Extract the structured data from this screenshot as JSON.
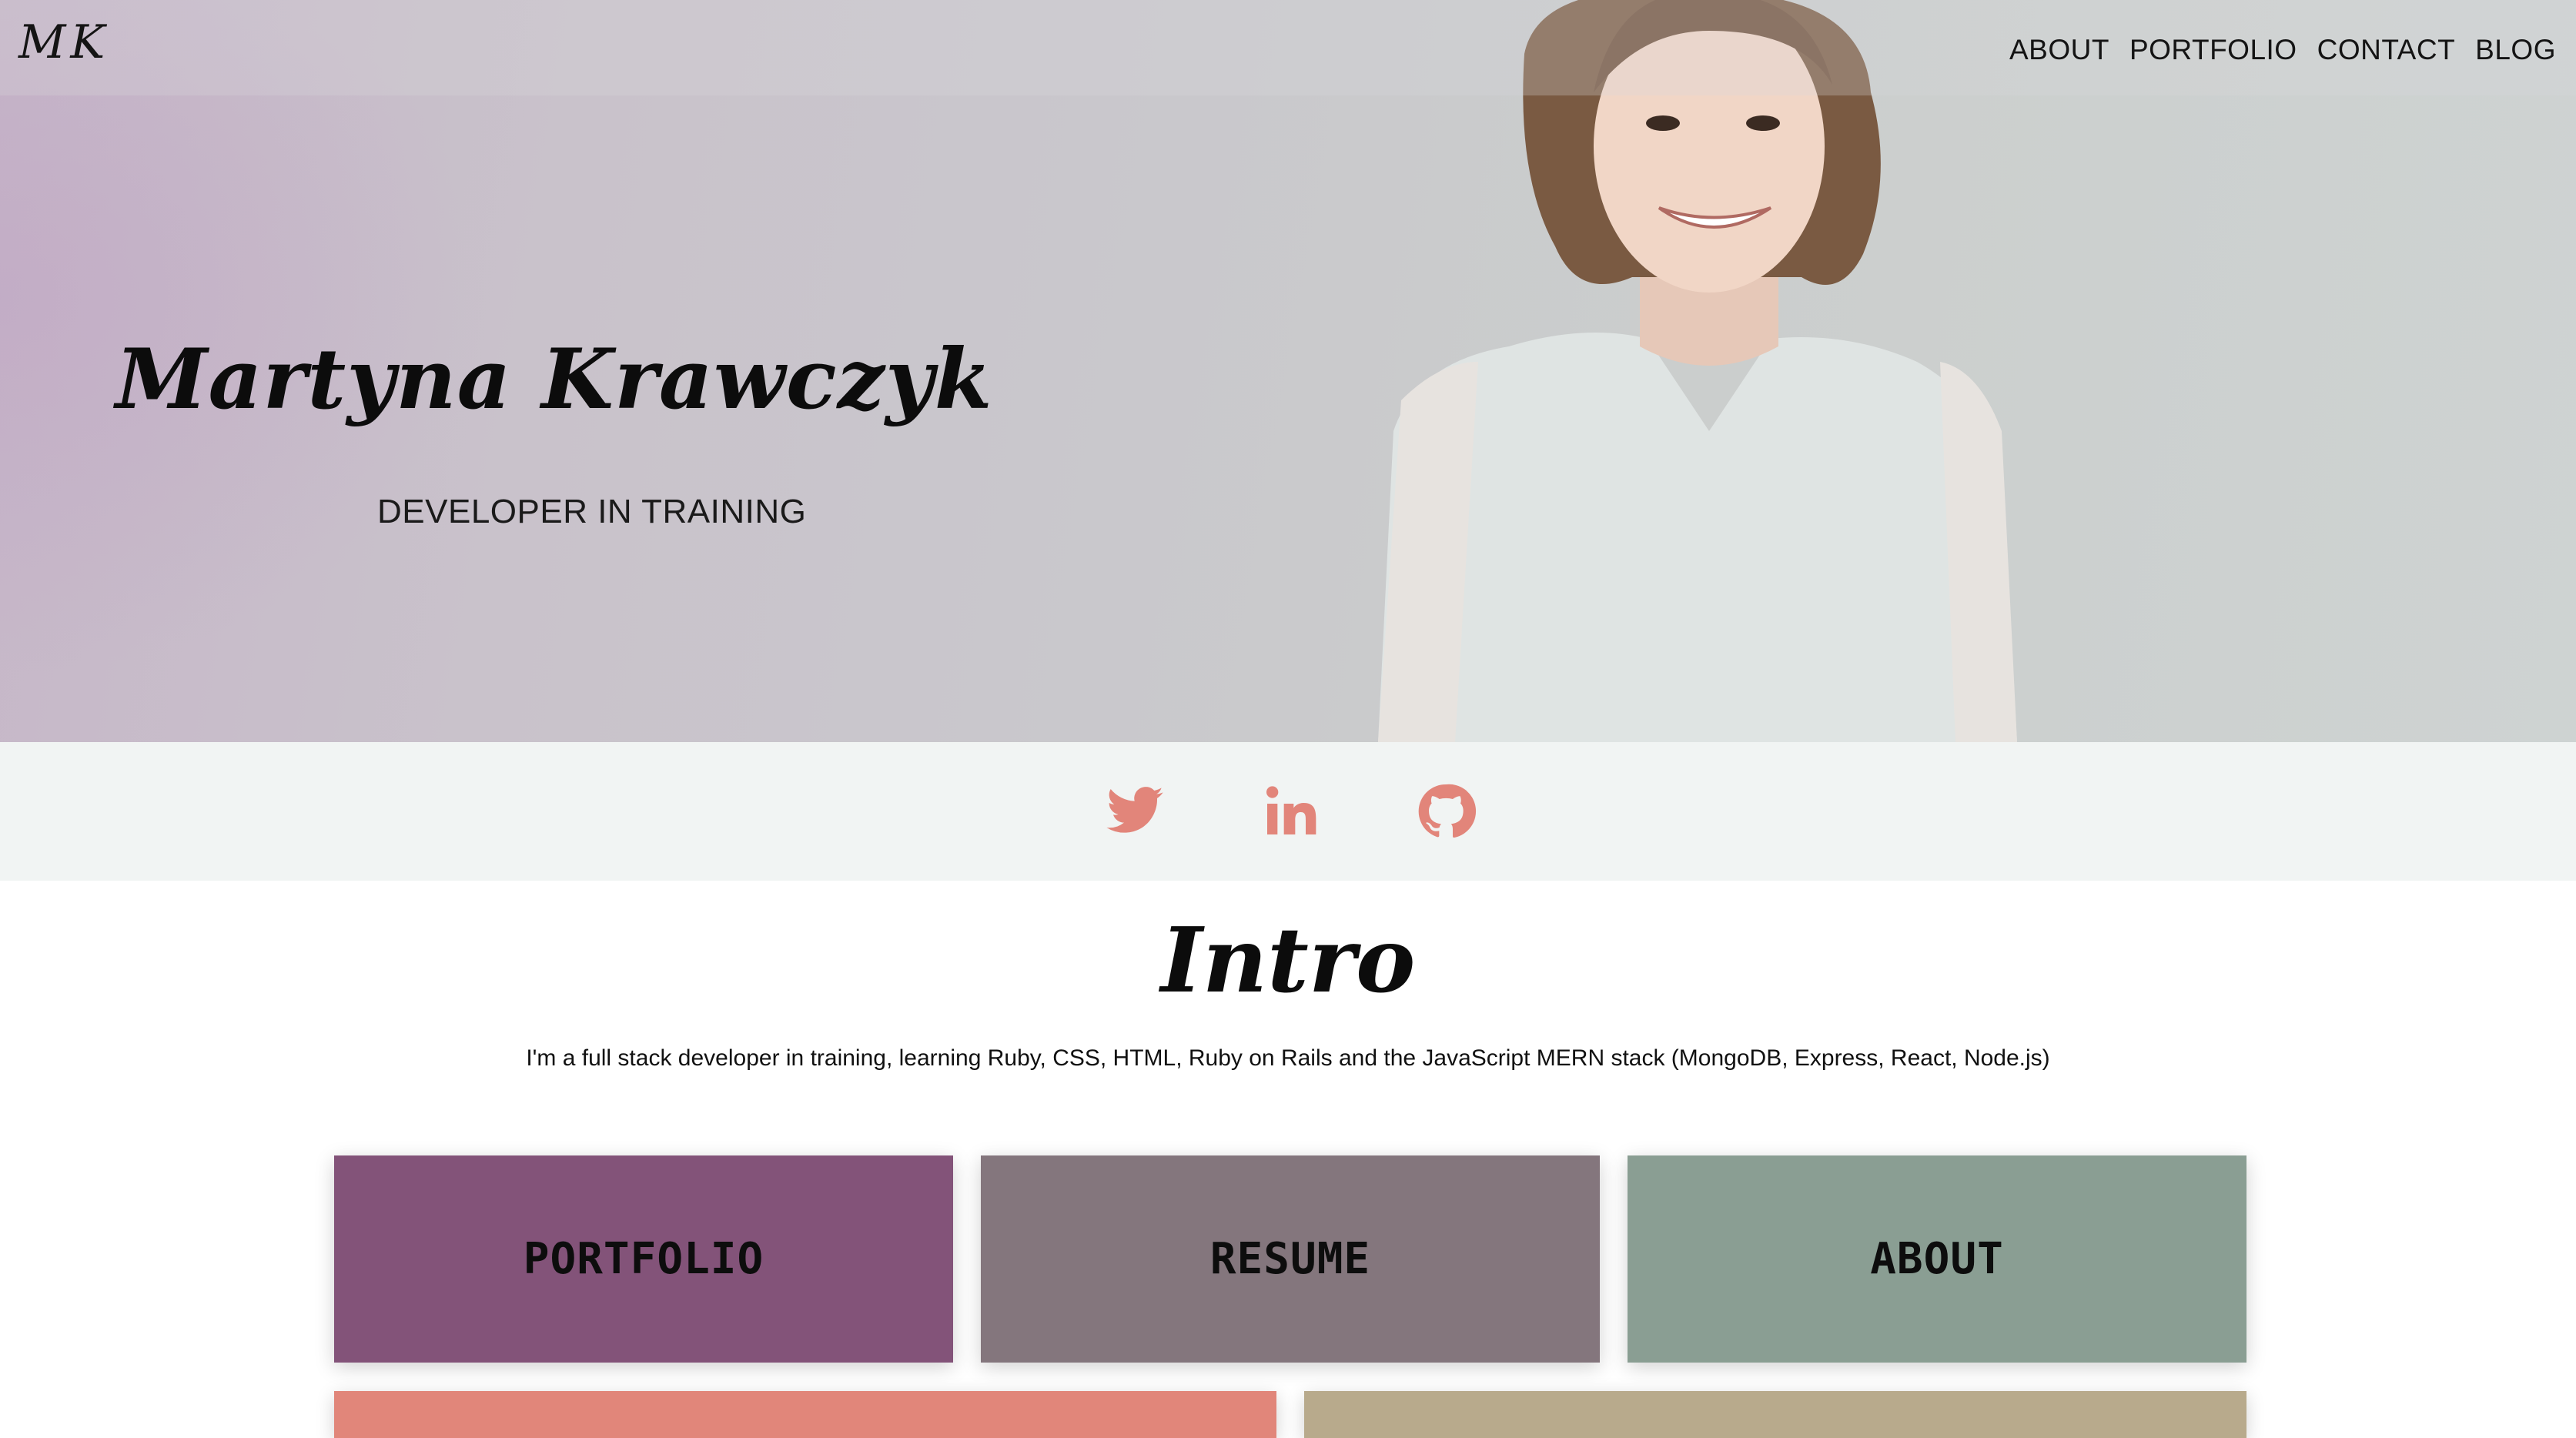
{
  "logo": "MK",
  "nav": {
    "links": [
      "ABOUT",
      "PORTFOLIO",
      "CONTACT",
      "BLOG"
    ]
  },
  "hero": {
    "name": "Martyna Krawczyk",
    "subtitle": "DEVELOPER IN TRAINING"
  },
  "social": {
    "icons": [
      "twitter-icon",
      "linkedin-icon",
      "github-icon"
    ],
    "color": "#e2857a"
  },
  "intro": {
    "title": "Intro",
    "text": "I'm a full stack developer in training, learning Ruby, CSS, HTML, Ruby on Rails and the JavaScript MERN stack (MongoDB, Express, React, Node.js)"
  },
  "cards": [
    {
      "label": "PORTFOLIO",
      "color": "#835379"
    },
    {
      "label": "RESUME",
      "color": "#84767d"
    },
    {
      "label": "ABOUT",
      "color": "#8a9e93"
    },
    {
      "label": "",
      "color": "#e1867a"
    },
    {
      "label": "",
      "color": "#b8aa8c"
    }
  ]
}
